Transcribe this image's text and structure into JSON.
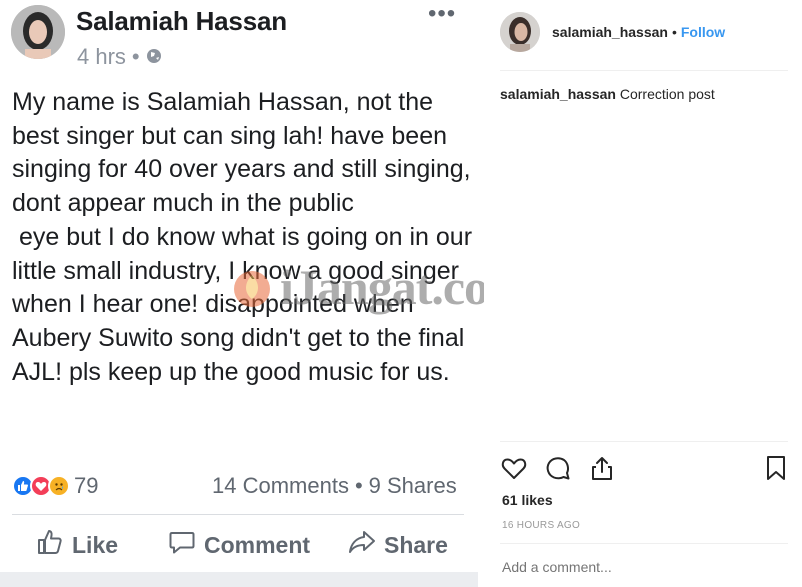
{
  "facebook": {
    "author": "Salamiah Hassan",
    "time": "4 hrs",
    "separator": "•",
    "more": "•••",
    "body": "My name is Salamiah Hassan, not the best singer but can sing lah! have been singing for 40 over years and still singing, dont appear much in the public\n eye but I do know what is going on in our little small industry, I know a good singer when I hear one! disappointed when Aubery Suwito song didn't get to the final AJL! pls keep up the good music for us.",
    "reactions_count": "79",
    "comments": "14 Comments",
    "counts_sep": "•",
    "shares": "9 Shares",
    "actions": {
      "like": "Like",
      "comment": "Comment",
      "share": "Share"
    },
    "colors": {
      "like": "#1877f2",
      "love": "#f33e58",
      "sad": "#f7b125"
    },
    "reaction_icons": [
      "like-reaction-icon",
      "love-reaction-icon",
      "sad-reaction-icon"
    ]
  },
  "watermark": "iJangat.com",
  "instagram": {
    "username": "salamiah_hassan",
    "dot": "•",
    "follow": "Follow",
    "caption_user": "salamiah_hassan",
    "caption_text": "Correction post",
    "likes": "61 likes",
    "time": "16 HOURS AGO",
    "add_comment_placeholder": "Add a comment...",
    "icons": [
      "heart-icon",
      "comment-icon",
      "share-icon",
      "bookmark-icon"
    ],
    "colors": {
      "follow": "#3897f0"
    }
  }
}
